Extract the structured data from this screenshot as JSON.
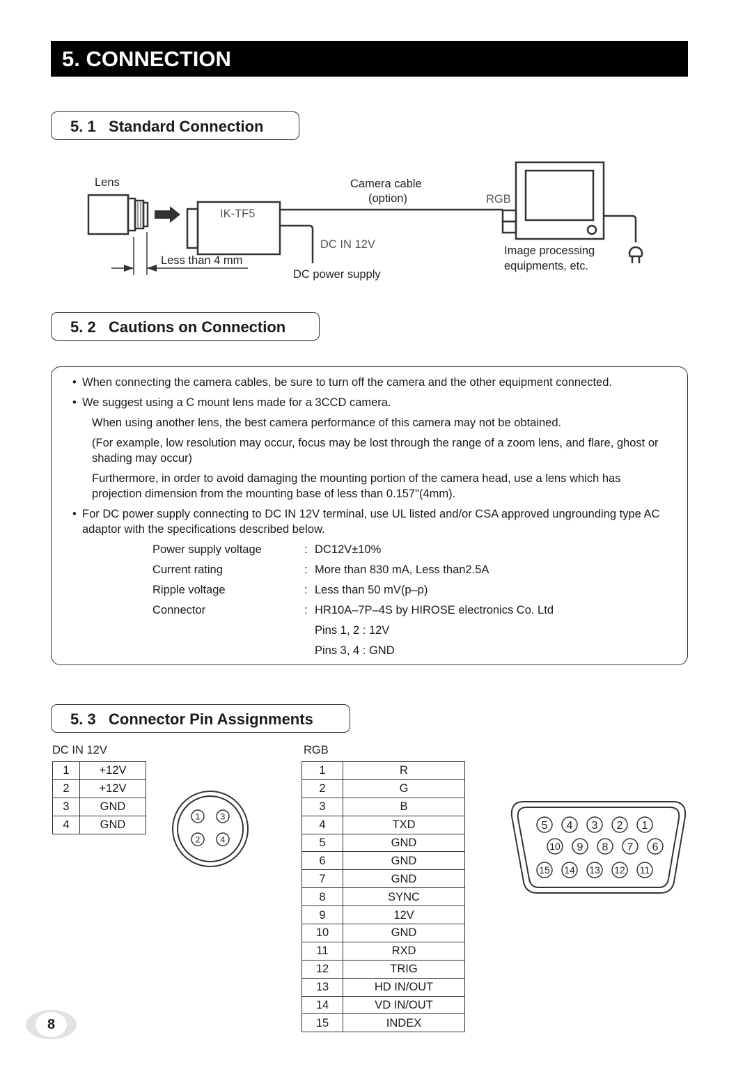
{
  "chapter": {
    "title": "5.  CONNECTION"
  },
  "sections": {
    "s1": {
      "title": "5. 1   Standard Connection"
    },
    "s2": {
      "title": "5. 2   Cautions on Connection"
    },
    "s3": {
      "title": "5. 3   Connector Pin Assignments"
    }
  },
  "diagram": {
    "lens_label": "Lens",
    "camera_model": "IK-TF5",
    "distance_label": "Less than 4 mm",
    "cable_label_line1": "Camera cable",
    "cable_label_line2": "(option)",
    "rgb_label": "RGB",
    "dc_in_label": "DC IN 12V",
    "dc_supply_label": "DC power supply",
    "equipment_label_line1": "Image processing",
    "equipment_label_line2": "equipments, etc."
  },
  "cautions": {
    "bullet1": "When connecting the camera cables, be sure to turn off the camera and the other equipment connected.",
    "bullet2": "We suggest using a C mount lens made for a 3CCD camera.",
    "para1": "When using another lens, the best camera performance of this camera may not be obtained.",
    "para2": "(For example, low resolution may occur, focus may be lost through the range of a zoom lens, and flare, ghost or shading may occur)",
    "para3": "Furthermore, in order to avoid damaging the mounting portion of the camera head, use a lens which has projection dimension from the mounting base of less than 0.157\"(4mm).",
    "bullet3": "For DC power supply connecting to DC IN 12V terminal, use UL listed and/or CSA approved ungrounding type AC adaptor with the specifications described below.",
    "specs": [
      {
        "label": "Power supply voltage",
        "value": "DC12V±10%"
      },
      {
        "label": "Current rating",
        "value": "More than 830 mA, Less than2.5A"
      },
      {
        "label": "Ripple voltage",
        "value": "Less than 50 mV(p–p)"
      },
      {
        "label": "Connector",
        "value": "HR10A–7P–4S by HIROSE electronics Co. Ltd"
      }
    ],
    "pins_note1": "Pins 1, 2 : 12V",
    "pins_note2": "Pins 3, 4 : GND",
    "colon": ":"
  },
  "dc_table": {
    "title": "DC IN 12V",
    "rows": [
      {
        "pin": "1",
        "signal": "+12V"
      },
      {
        "pin": "2",
        "signal": "+12V"
      },
      {
        "pin": "3",
        "signal": "GND"
      },
      {
        "pin": "4",
        "signal": "GND"
      }
    ],
    "connector_pins": [
      "1",
      "2",
      "3",
      "4"
    ]
  },
  "rgb_table": {
    "title": "RGB",
    "rows": [
      {
        "pin": "1",
        "signal": "R"
      },
      {
        "pin": "2",
        "signal": "G"
      },
      {
        "pin": "3",
        "signal": "B"
      },
      {
        "pin": "4",
        "signal": "TXD"
      },
      {
        "pin": "5",
        "signal": "GND"
      },
      {
        "pin": "6",
        "signal": "GND"
      },
      {
        "pin": "7",
        "signal": "GND"
      },
      {
        "pin": "8",
        "signal": "SYNC"
      },
      {
        "pin": "9",
        "signal": "12V"
      },
      {
        "pin": "10",
        "signal": "GND"
      },
      {
        "pin": "11",
        "signal": "RXD"
      },
      {
        "pin": "12",
        "signal": "TRIG"
      },
      {
        "pin": "13",
        "signal": "HD  IN/OUT"
      },
      {
        "pin": "14",
        "signal": "VD  IN/OUT"
      },
      {
        "pin": "15",
        "signal": "INDEX"
      }
    ],
    "connector_rows": [
      [
        "5",
        "4",
        "3",
        "2",
        "1"
      ],
      [
        "10",
        "9",
        "8",
        "7",
        "6"
      ],
      [
        "15",
        "14",
        "13",
        "12",
        "11"
      ]
    ]
  },
  "page_number": "8"
}
